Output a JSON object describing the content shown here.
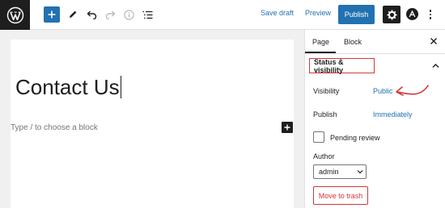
{
  "toolbar": {
    "logo_icon": "wordpress-logo-icon",
    "save_draft_label": "Save draft",
    "preview_label": "Preview",
    "publish_label": "Publish",
    "accent_color": "#2271b1"
  },
  "editor": {
    "title": "Contact Us",
    "block_placeholder": "Type / to choose a block"
  },
  "sidebar": {
    "tabs": [
      {
        "label": "Page",
        "active": true
      },
      {
        "label": "Block",
        "active": false
      }
    ],
    "panel_title": "Status & visibility",
    "visibility_label": "Visibility",
    "visibility_value": "Public",
    "publish_label": "Publish",
    "publish_value": "Immediately",
    "pending_review_label": "Pending review",
    "pending_review_checked": false,
    "author_label": "Author",
    "author_value": "admin",
    "move_to_trash_label": "Move to trash",
    "highlight_color": "#d63638"
  }
}
